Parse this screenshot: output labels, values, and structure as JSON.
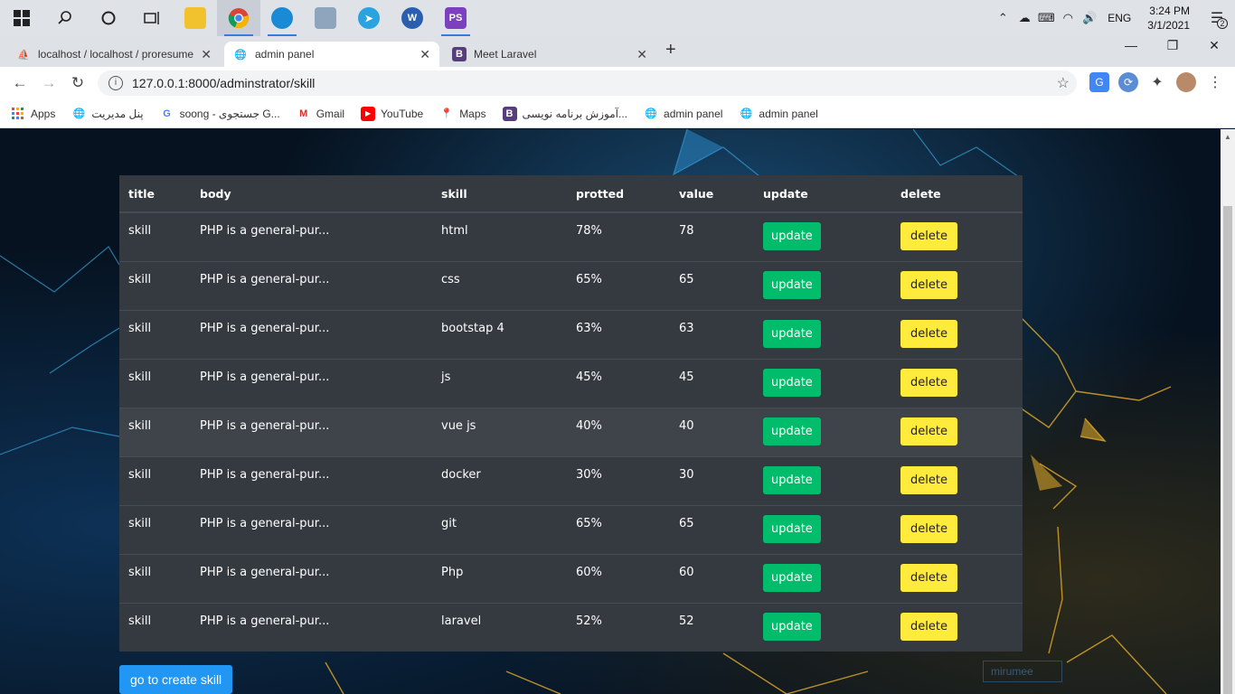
{
  "taskbar": {
    "tray_language": "ENG",
    "clock_time": "3:24 PM",
    "clock_date": "3/1/2021",
    "notification_count": "2"
  },
  "tabs": [
    {
      "title": "localhost / localhost / proresume"
    },
    {
      "title": "admin panel"
    },
    {
      "title": "Meet Laravel"
    }
  ],
  "address": "127.0.0.1:8000/adminstrator/skill",
  "bookmarks": [
    {
      "label": "Apps"
    },
    {
      "label": "پنل مدیریت"
    },
    {
      "label": "soong - جستجوی G..."
    },
    {
      "label": "Gmail"
    },
    {
      "label": "YouTube"
    },
    {
      "label": "Maps"
    },
    {
      "label": "آموزش برنامه نویسی..."
    },
    {
      "label": "admin panel"
    },
    {
      "label": "admin panel"
    }
  ],
  "table": {
    "headers": [
      "title",
      "body",
      "skill",
      "protted",
      "value",
      "update",
      "delete"
    ],
    "rows": [
      {
        "title": "skill",
        "body": "PHP is a general-pur...",
        "skill": "html",
        "protted": "78%",
        "value": "78",
        "update": "update",
        "delete": "delete"
      },
      {
        "title": "skill",
        "body": "PHP is a general-pur...",
        "skill": "css",
        "protted": "65%",
        "value": "65",
        "update": "update",
        "delete": "delete"
      },
      {
        "title": "skill",
        "body": "PHP is a general-pur...",
        "skill": "bootstap 4",
        "protted": "63%",
        "value": "63",
        "update": "update",
        "delete": "delete"
      },
      {
        "title": "skill",
        "body": "PHP is a general-pur...",
        "skill": "js",
        "protted": "45%",
        "value": "45",
        "update": "update",
        "delete": "delete"
      },
      {
        "title": "skill",
        "body": "PHP is a general-pur...",
        "skill": "vue js",
        "protted": "40%",
        "value": "40",
        "update": "update",
        "delete": "delete"
      },
      {
        "title": "skill",
        "body": "PHP is a general-pur...",
        "skill": "docker",
        "protted": "30%",
        "value": "30",
        "update": "update",
        "delete": "delete"
      },
      {
        "title": "skill",
        "body": "PHP is a general-pur...",
        "skill": "git",
        "protted": "65%",
        "value": "65",
        "update": "update",
        "delete": "delete"
      },
      {
        "title": "skill",
        "body": "PHP is a general-pur...",
        "skill": "Php",
        "protted": "60%",
        "value": "60",
        "update": "update",
        "delete": "delete"
      },
      {
        "title": "skill",
        "body": "PHP is a general-pur...",
        "skill": "laravel",
        "protted": "52%",
        "value": "52",
        "update": "update",
        "delete": "delete"
      }
    ]
  },
  "create_button": "go to create skill",
  "watermark": "mirumee",
  "colors": {
    "update_button": "#00bc6b",
    "delete_button": "#ffeb3b",
    "create_button": "#2196f3",
    "table_bg": "#343a40"
  }
}
